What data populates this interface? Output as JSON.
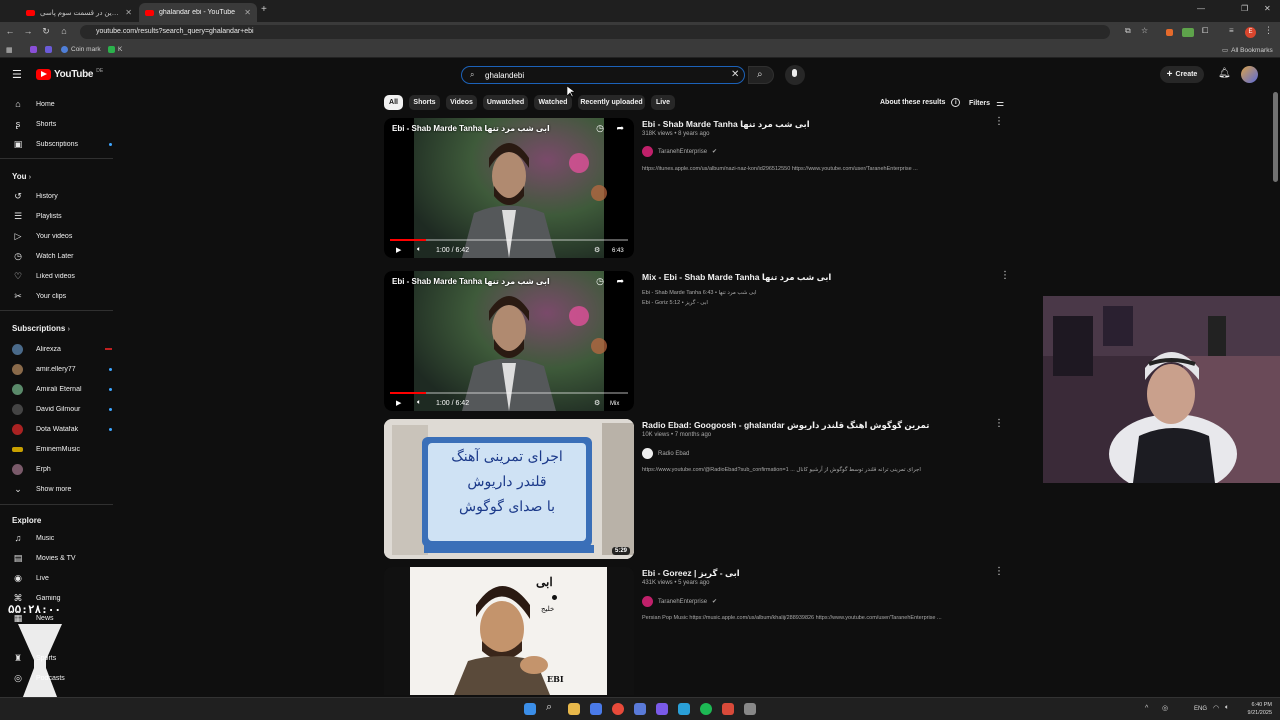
{
  "browser": {
    "tabs": [
      {
        "title": "فرزاد فرزین در قسمت سوم پاسی",
        "active": false
      },
      {
        "title": "ghalandar ebi - YouTube",
        "active": true
      }
    ],
    "url": "youtube.com/results?search_query=ghalandar+ebi",
    "bookmarks": [
      "Coin mark",
      "K"
    ],
    "all_bookmarks_label": "All Bookmarks"
  },
  "header": {
    "logo_text": "YouTube",
    "country_code": "DE",
    "search_value": "ghalandebi",
    "create_label": "Create"
  },
  "sidebar": {
    "main": [
      {
        "label": "Home",
        "icon": "home-icon"
      },
      {
        "label": "Shorts",
        "icon": "shorts-icon"
      },
      {
        "label": "Subscriptions",
        "icon": "subscriptions-icon"
      }
    ],
    "you_heading": "You",
    "you_items": [
      {
        "label": "History",
        "icon": "history-icon"
      },
      {
        "label": "Playlists",
        "icon": "playlists-icon"
      },
      {
        "label": "Your videos",
        "icon": "your-videos-icon"
      },
      {
        "label": "Watch Later",
        "icon": "watch-later-icon"
      },
      {
        "label": "Liked videos",
        "icon": "liked-icon"
      },
      {
        "label": "Your clips",
        "icon": "clips-icon"
      }
    ],
    "subscriptions_heading": "Subscriptions",
    "subscriptions": [
      {
        "label": "Alirexza",
        "color": "#4a6a8a",
        "badge": "live"
      },
      {
        "label": "amir.ellery77",
        "color": "#8a6a4a",
        "badge": "dot"
      },
      {
        "label": "Amirali Eternal",
        "color": "#5a8a6a",
        "badge": "dot"
      },
      {
        "label": "David Gilmour",
        "color": "#444444",
        "badge": "dot"
      },
      {
        "label": "Dota Watafak",
        "color": "#aa2222",
        "badge": "dot"
      },
      {
        "label": "EminemMusic",
        "color": "#c8a000",
        "badge": "none"
      },
      {
        "label": "Erph",
        "color": "#7a5a6a",
        "badge": "none"
      }
    ],
    "show_more": "Show more",
    "explore_heading": "Explore",
    "explore": [
      {
        "label": "Music",
        "icon": "music-icon"
      },
      {
        "label": "Movies & TV",
        "icon": "movies-icon"
      },
      {
        "label": "Live",
        "icon": "live-icon"
      },
      {
        "label": "Gaming",
        "icon": "gaming-icon"
      },
      {
        "label": "News",
        "icon": "news-icon"
      },
      {
        "label": "Sports",
        "icon": "trophy-icon"
      },
      {
        "label": "Podcasts",
        "icon": "podcasts-icon"
      }
    ]
  },
  "chips": [
    "All",
    "Shorts",
    "Videos",
    "Unwatched",
    "Watched",
    "Recently uploaded",
    "Live"
  ],
  "about_results": "About these results",
  "filters_label": "Filters",
  "results": [
    {
      "title": "Ebi - Shab Marde Tanha ابی شب مرد تنها",
      "overlay_title": "Ebi - Shab Marde Tanha ابی شب مرد تنها",
      "meta": "318K views • 8 years ago",
      "channel": "TaranehEnterprise",
      "verified": true,
      "desc": "https://itunes.apple.com/us/album/nazi-naz-kon/id296512550 https://www.youtube.com/user/TaranehEnterprise ...",
      "time": "1:00 / 6:42",
      "badge": "6:43",
      "progress": 0.15
    },
    {
      "title": "Mix - Ebi - Shab Marde Tanha ابی  شب مرد تنها",
      "overlay_title": "Ebi - Shab Marde Tanha ابی شب مرد تنها",
      "lines": [
        "Ebi - Shab Marde Tanha 6:43 • ابی شب مرد تنها",
        "Ebi - Goriz 5:12 • ابی - گریز"
      ],
      "time": "1:00 / 6:42",
      "badge": "Mix",
      "progress": 0.15
    },
    {
      "title": "Radio Ebad: Googoosh - ghalandar تمرین گوگوش اهنگ قلندر داریوش",
      "meta": "10K views • 7 months ago",
      "channel": "Radio Ebad",
      "verified": false,
      "desc": "https://www.youtube.com/@RadioEbad?sub_confirmation=1 ... اجرای تمرینی ترانه قلندر توسط گوگوش از آرشیو کانال",
      "duration": "5:29",
      "thumb_text": [
        "اجرای تمرینی آهنگ",
        "قلندر داریوش",
        "با صدای گوگوش"
      ]
    },
    {
      "title": "Ebi - Goreez | ابی - گریز",
      "meta": "431K views • 5 years ago",
      "channel": "TaranehEnterprise",
      "verified": true,
      "desc": "Persian Pop Music https://music.apple.com/us/album/khalij/288939826 https://www.youtube.com/user/TaranehEnterprise ...",
      "cover_title": "ابی",
      "cover_sub": "خلیج",
      "cover_label": "EBI"
    }
  ],
  "overlay_clock": "۵۵:۲۸:۰۰",
  "tray": {
    "lang": "ENG",
    "time": "6:40 PM",
    "date": "9/21/2025"
  }
}
